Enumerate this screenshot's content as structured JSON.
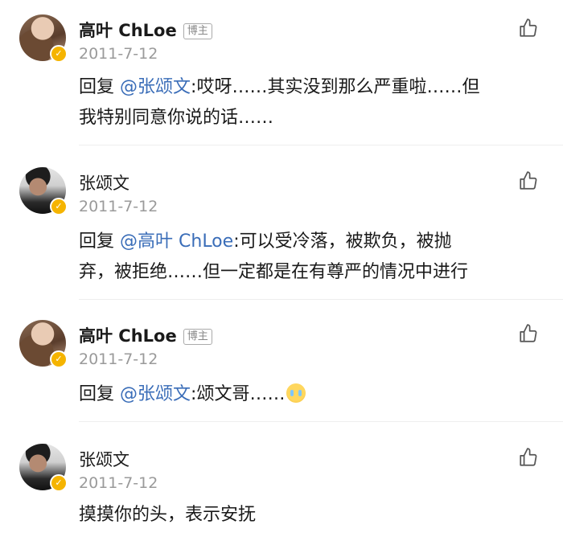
{
  "comments": [
    {
      "author": "高叶 ChLoe",
      "badge": "博主",
      "date": "2011-7-12",
      "reply_prefix": "回复",
      "mention": "@张颂文",
      "text_line1": ":哎呀……其实没到那么严重啦……但",
      "text_line2": "我特别同意你说的话……"
    },
    {
      "author": "张颂文",
      "date": "2011-7-12",
      "reply_prefix": "回复",
      "mention": "@高叶 ChLoe",
      "text_line1": ":可以受冷落，被欺负，被抛",
      "text_line2": "弃，被拒绝……但一定都是在有尊严的情况中进行"
    },
    {
      "author": "高叶 ChLoe",
      "badge": "博主",
      "date": "2011-7-12",
      "reply_prefix": "回复",
      "mention": "@张颂文",
      "text_line1": ":颂文哥……",
      "emoji": "crying-face-emoji"
    },
    {
      "author": "张颂文",
      "date": "2011-7-12",
      "text_line1": "摸摸你的头，表示安抚"
    }
  ],
  "icons": {
    "like": "thumbs-up-icon",
    "verified": "verified-badge-icon"
  },
  "colors": {
    "mention": "#3a6db8",
    "date": "#9a9a9a",
    "verified": "#f5b400"
  }
}
